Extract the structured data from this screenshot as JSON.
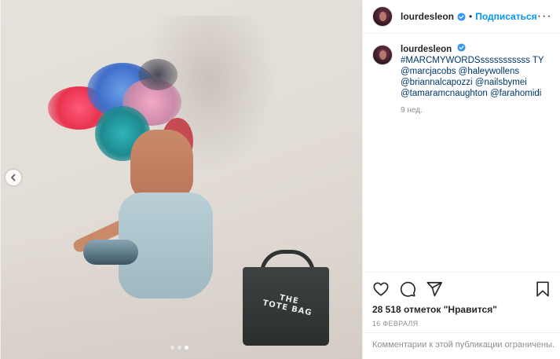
{
  "post": {
    "username": "lourdesleon",
    "follow_label": "Подписаться",
    "separator": "•",
    "more_label": "···",
    "caption": {
      "username": "lourdesleon",
      "lines": [
        "#MARCMYWORDSsssssssssss TY",
        "@marcjacobs @haleywollens",
        "@briannalcapozzi @nailsbymei",
        "@tamaramcnaughton @farahomidi"
      ],
      "time_ago": "9 нед."
    },
    "media": {
      "bag_text_line1": "THE",
      "bag_text_line2": "TOTE BAG",
      "carousel": {
        "count": 3,
        "active_index": 2
      }
    },
    "likes": "28 518 отметок \"Нравится\"",
    "date": "16 ФЕВРАЛЯ",
    "comments_restricted": "Комментарии к этой публикации ограничены."
  },
  "icons": {
    "verified": "verified-badge-icon",
    "like": "heart-icon",
    "comment": "comment-icon",
    "share": "share-icon",
    "save": "bookmark-icon",
    "prev": "chevron-left-icon"
  },
  "colors": {
    "link": "#00376b",
    "follow": "#0095f6",
    "verified": "#3897f0",
    "muted": "#8e8e8e"
  }
}
